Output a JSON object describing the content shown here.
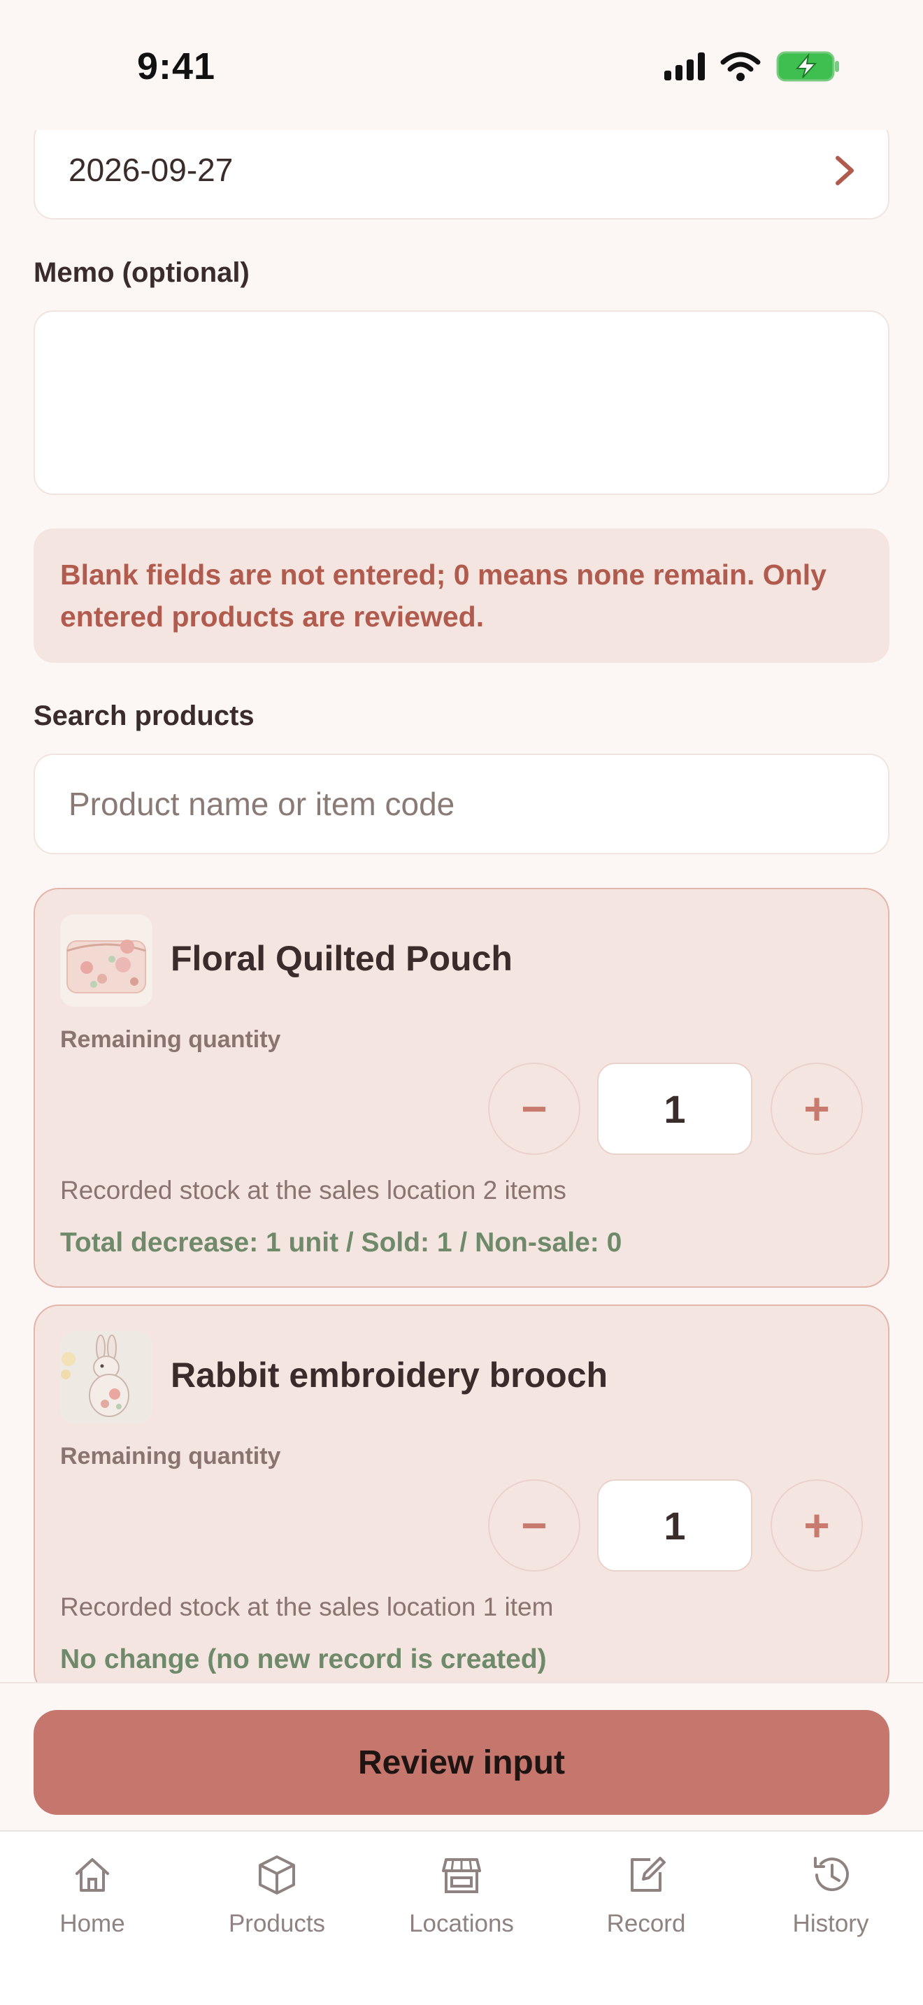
{
  "status_bar": {
    "time": "9:41"
  },
  "form": {
    "date_value": "2026-09-27",
    "memo_label": "Memo (optional)",
    "memo_value": "",
    "notice": "Blank fields are not entered; 0 means none remain. Only entered products are reviewed.",
    "search_label": "Search products",
    "search_placeholder": "Product name or item code"
  },
  "products": [
    {
      "name": "Floral Quilted Pouch",
      "remaining_label": "Remaining quantity",
      "quantity": "1",
      "stock_text": "Recorded stock at the sales location 2 items",
      "status_text": "Total decrease: 1 unit / Sold: 1 / Non-sale: 0"
    },
    {
      "name": "Rabbit embroidery brooch",
      "remaining_label": "Remaining quantity",
      "quantity": "1",
      "stock_text": "Recorded stock at the sales location 1 item",
      "status_text": "No change (no new record is created)"
    }
  ],
  "stepper": {
    "minus": "−",
    "plus": "+"
  },
  "actions": {
    "review_label": "Review input"
  },
  "tabs": [
    {
      "label": "Home",
      "icon": "home-icon"
    },
    {
      "label": "Products",
      "icon": "box-icon"
    },
    {
      "label": "Locations",
      "icon": "store-icon"
    },
    {
      "label": "Record",
      "icon": "edit-icon"
    },
    {
      "label": "History",
      "icon": "history-icon"
    }
  ],
  "colors": {
    "background": "#fcf7f4",
    "accent": "#c6776d",
    "card_bg": "#f5e5e1",
    "status_green": "#6f8a6a",
    "notice_text": "#b15a4e"
  }
}
